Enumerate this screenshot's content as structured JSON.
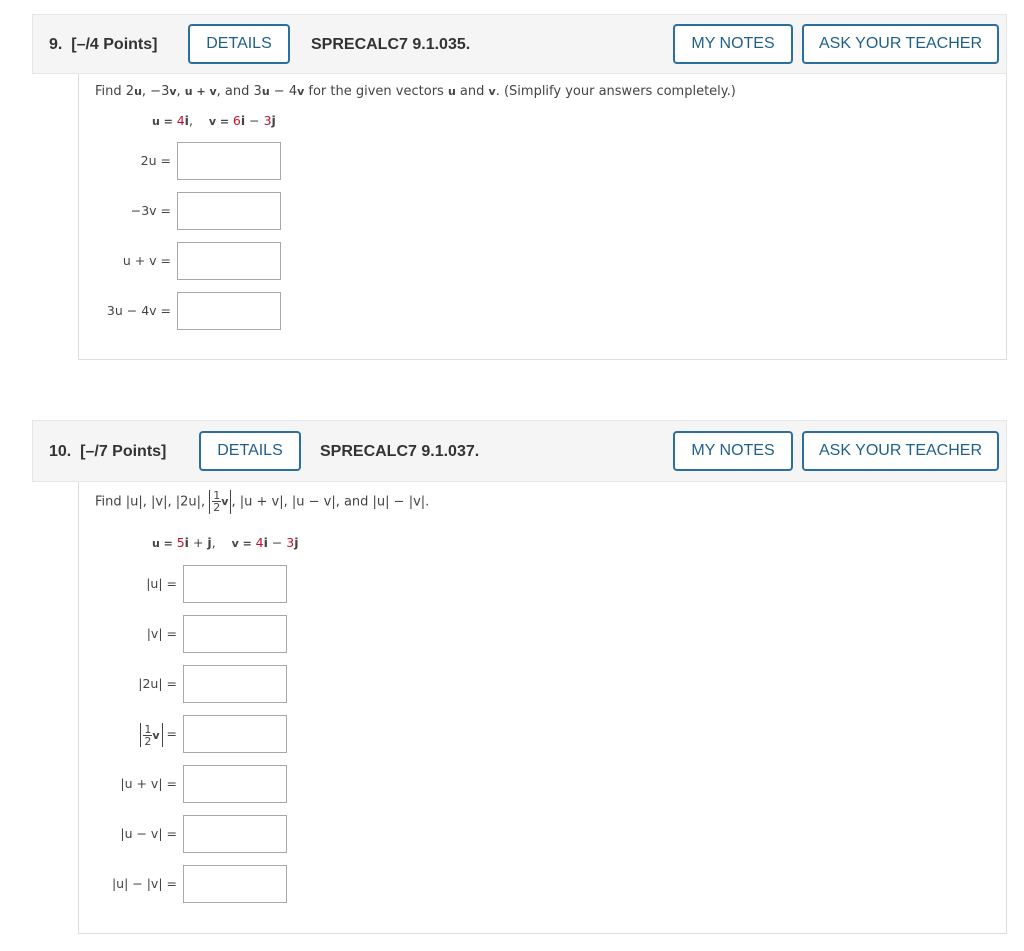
{
  "questions": [
    {
      "number": "9.",
      "points": "[–/4 Points]",
      "details_label": "DETAILS",
      "code": "SPRECALC7 9.1.035.",
      "notes_label": "MY NOTES",
      "ask_label": "ASK YOUR TEACHER",
      "prompt": {
        "find": "Find ",
        "t1": "2",
        "t1b": "u",
        "sep1": ", −3",
        "t2b": "v",
        "sep2": ", ",
        "t3b": "u + v",
        "sep3": ", and 3",
        "t4b": "u",
        "t4c": " − 4",
        "t4d": "v",
        "tail1": " for the given vectors ",
        "ub": "u",
        "and": " and ",
        "vb": "v",
        "tail2": ". (Simplify your answers completely.)"
      },
      "vectors": {
        "u_label": "u = ",
        "u_coef": "4",
        "u_i": "i",
        "u_end": ",",
        "v_label": "v = ",
        "v_coef1": "6",
        "v_i": "i",
        "v_op": " − ",
        "v_coef2": "3",
        "v_j": "j"
      },
      "answers": [
        {
          "label": "2u =",
          "value": ""
        },
        {
          "label": "−3v =",
          "value": ""
        },
        {
          "label": "u + v =",
          "value": ""
        },
        {
          "label": "3u − 4v =",
          "value": ""
        }
      ]
    },
    {
      "number": "10.",
      "points": "[–/7 Points]",
      "details_label": "DETAILS",
      "code": "SPRECALC7 9.1.037.",
      "notes_label": "MY NOTES",
      "ask_label": "ASK YOUR TEACHER",
      "prompt": {
        "find": "Find |u|, |v|, |2u|, ",
        "frac_num": "1",
        "frac_den": "2",
        "frac_var": "v",
        "tail": ", |u + v|, |u − v|, and |u| − |v|."
      },
      "vectors": {
        "u_label": "u = ",
        "u_coef1": "5",
        "u_i": "i",
        "u_op": " + ",
        "u_j": "j",
        "u_end": ",",
        "v_label": "v = ",
        "v_coef1": "4",
        "v_i": "i",
        "v_op": " − ",
        "v_coef2": "3",
        "v_j": "j"
      },
      "answers": [
        {
          "label": "|u| =",
          "value": ""
        },
        {
          "label": "|v| =",
          "value": ""
        },
        {
          "label": "|2u| =",
          "value": ""
        },
        {
          "label_frac_num": "1",
          "label_frac_den": "2",
          "label_var": "v",
          "label_eq": "=",
          "value": ""
        },
        {
          "label": "|u + v| =",
          "value": ""
        },
        {
          "label": "|u − v| =",
          "value": ""
        },
        {
          "label": "|u| − |v| =",
          "value": ""
        }
      ]
    }
  ],
  "colors": {
    "accent": "#2a6fa0",
    "coefficient_red": "#c8102e",
    "header_bg": "#f5f5f5"
  }
}
